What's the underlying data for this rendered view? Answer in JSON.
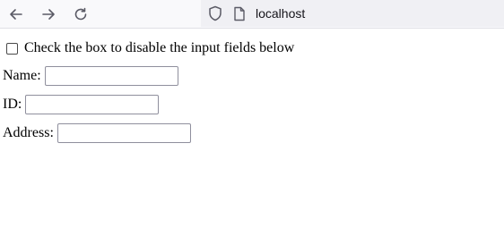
{
  "browser": {
    "back_icon": "arrow-left-icon",
    "forward_icon": "arrow-right-icon",
    "reload_icon": "reload-icon",
    "shield_icon": "shield-icon",
    "page_icon": "page-icon",
    "url": "localhost"
  },
  "form": {
    "checkbox_label": "Check the box to disable the input fields below",
    "checkbox_checked": false,
    "fields": [
      {
        "label": "Name:",
        "value": ""
      },
      {
        "label": "ID:",
        "value": ""
      },
      {
        "label": "Address:",
        "value": ""
      }
    ]
  }
}
